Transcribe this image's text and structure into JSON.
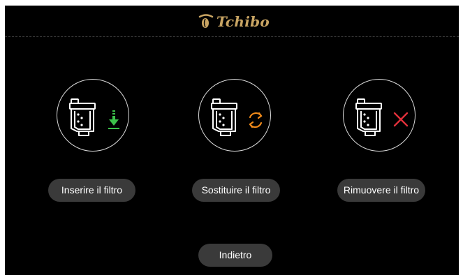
{
  "brand": {
    "name": "Tchibo",
    "color": "#c9a563"
  },
  "options": [
    {
      "label": "Inserire il filtro",
      "action_icon": "arrow-down-icon",
      "accent": "#3cc24a"
    },
    {
      "label": "Sostituire il filtro",
      "action_icon": "refresh-icon",
      "accent": "#f08a1a"
    },
    {
      "label": "Rimuovere il filtro",
      "action_icon": "close-icon",
      "accent": "#e0303a"
    }
  ],
  "back_label": "Indietro",
  "colors": {
    "background": "#000000",
    "button": "#3a3a3a",
    "text": "#ffffff",
    "outline": "#d9d9d9"
  }
}
